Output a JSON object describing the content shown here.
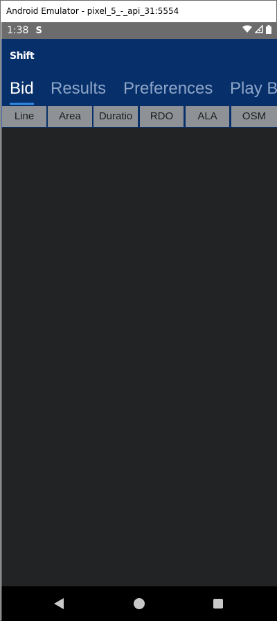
{
  "window": {
    "title": "Android Emulator - pixel_5_-_api_31:5554"
  },
  "status_bar": {
    "time": "1:38",
    "app_icon": "S",
    "icons": [
      "wifi-icon",
      "signal-icon",
      "battery-icon"
    ]
  },
  "app": {
    "logo_text": "Shift",
    "tabs": [
      {
        "label": "Bid",
        "active": true
      },
      {
        "label": "Results",
        "active": false
      },
      {
        "label": "Preferences",
        "active": false
      },
      {
        "label": "Play By",
        "active": false
      }
    ],
    "columns": [
      "Line",
      "Area",
      "Duratio",
      "RDO",
      "ALA",
      "OSM"
    ]
  },
  "nav_bar": {
    "buttons": [
      "back-icon",
      "home-icon",
      "recents-icon"
    ]
  },
  "colors": {
    "app_bar": "#07306a",
    "tab_active": "#ffffff",
    "tab_inactive": "#8ea5c8",
    "indicator": "#2e86de",
    "column_header": "#8e9297",
    "background": "#222324"
  }
}
